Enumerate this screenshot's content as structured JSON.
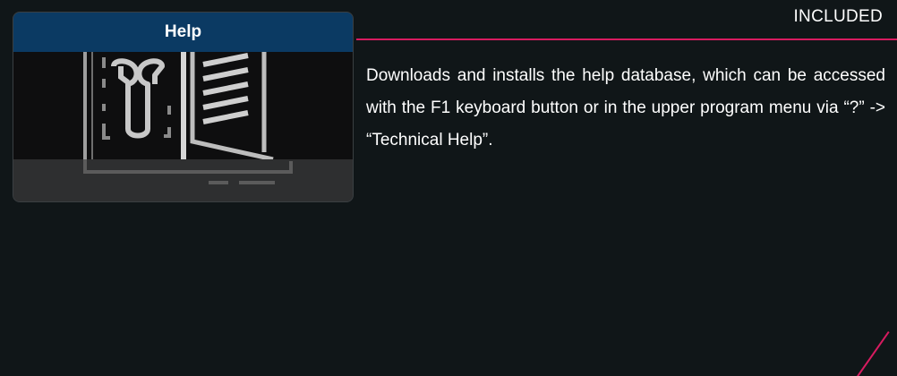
{
  "badge": {
    "label": "INCLUDED"
  },
  "card": {
    "title": "Help",
    "image_icon": "wrench-and-manual-icon"
  },
  "description": "Downloads and installs the help database, which can be accessed with the F1 keyboard button or in the upper program menu via “?” -> “Technical Help”.",
  "colors": {
    "background": "#101618",
    "accent": "#d81b60",
    "card_header": "#0b3a63",
    "text": "#ffffff"
  }
}
